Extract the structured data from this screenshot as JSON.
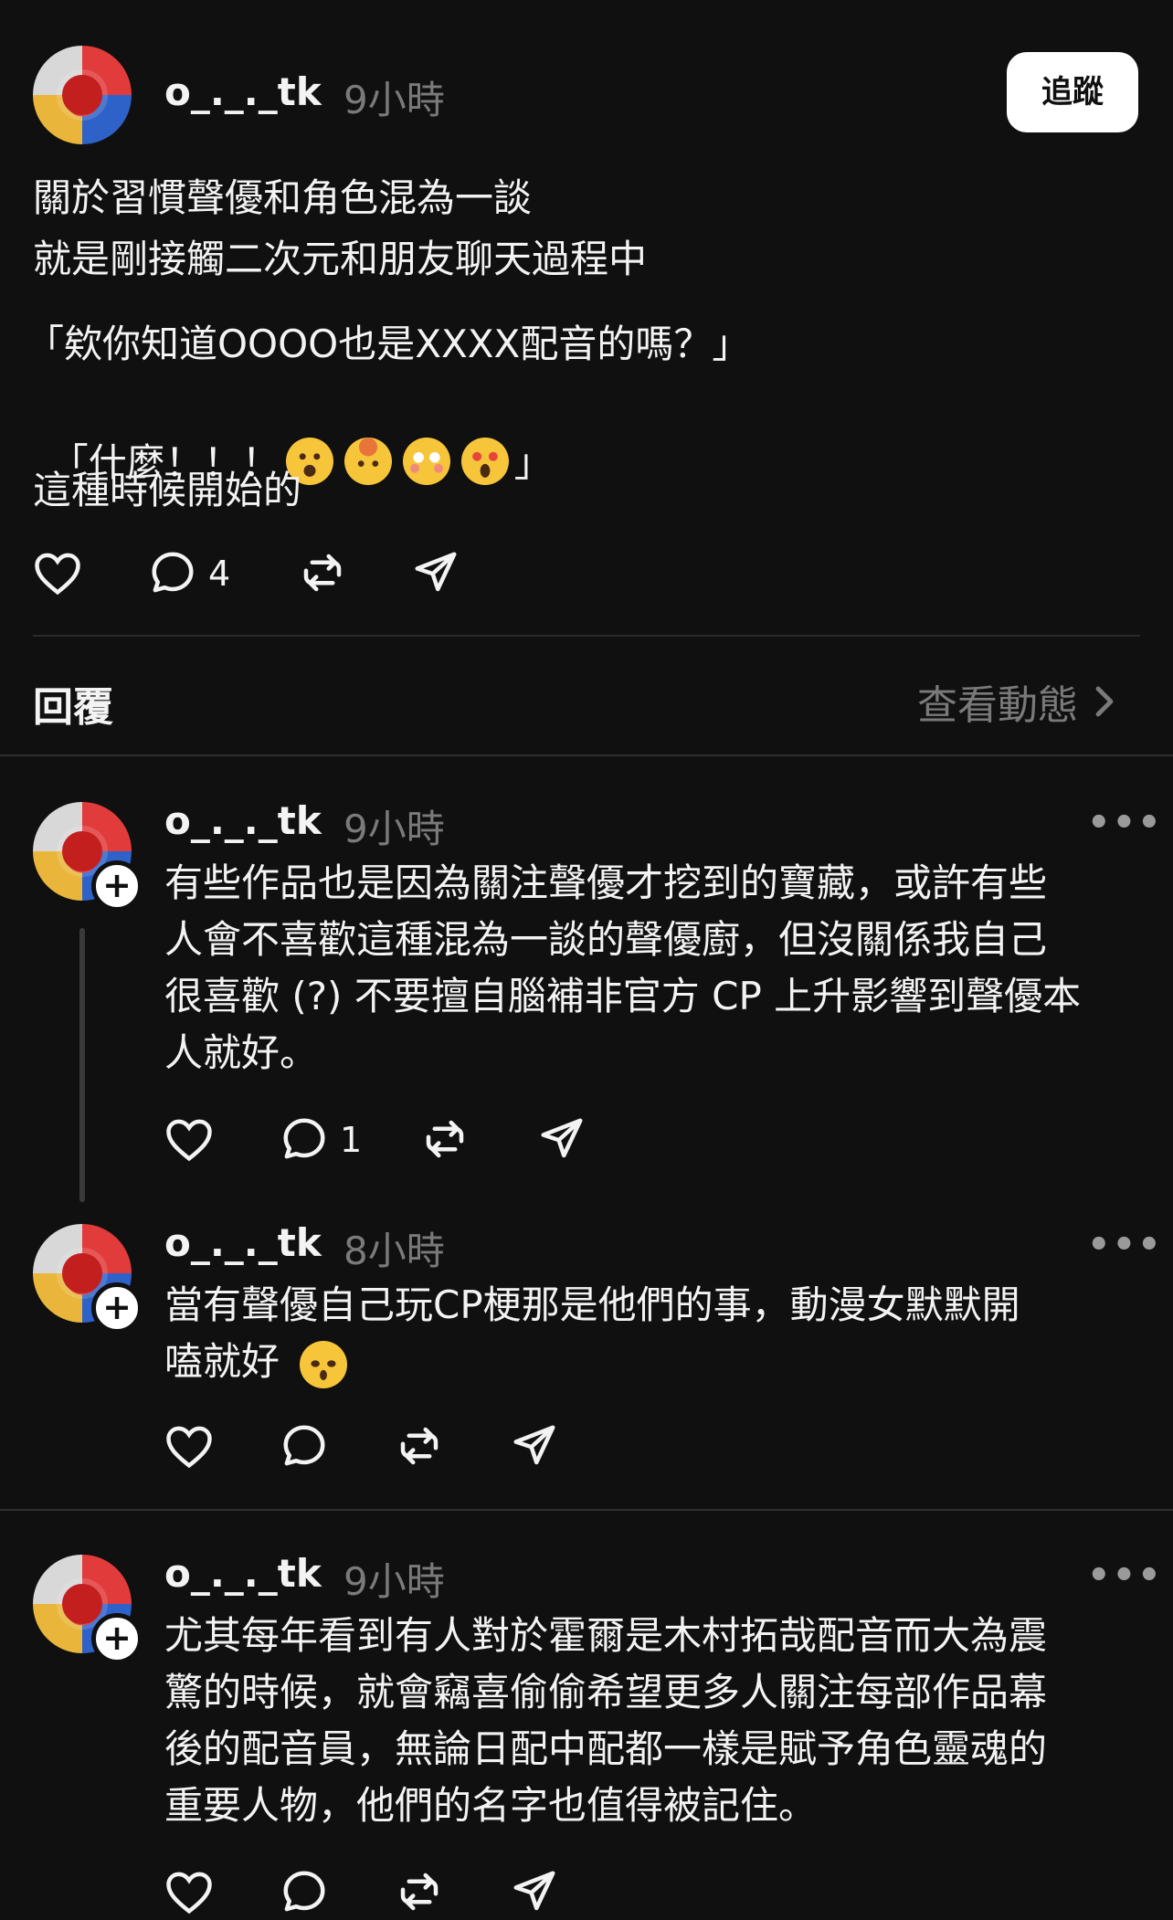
{
  "main_post": {
    "username": "o_._._tk",
    "time": "9小時",
    "follow_label": "追蹤",
    "lines": [
      "關於習慣聲優和角色混為一談",
      "就是剛接觸二次元和朋友聊天過程中",
      "「欸你知道OOOO也是XXXX配音的嗎？」",
      "「什麼！！！",
      "」",
      "這種時候開始的"
    ],
    "reply_count": "4"
  },
  "section": {
    "title": "回覆",
    "link_label": "查看動態"
  },
  "replies": [
    {
      "username": "o_._._tk",
      "time": "9小時",
      "text": "有些作品也是因為關注聲優才挖到的寶藏，或許有些\n人會不喜歡這種混為一談的聲優廚，但沒關係我自己\n很喜歡 (?) 不要擅自腦補非官方 CP 上升影響到聲優本\n人就好。",
      "reply_count": "1"
    },
    {
      "username": "o_._._tk",
      "time": "8小時",
      "text": "當有聲優自己玩CP梗那是他們的事，動漫女默默開\n嗑就好",
      "reply_count": ""
    },
    {
      "username": "o_._._tk",
      "time": "9小時",
      "text": "尤其每年看到有人對於霍爾是木村拓哉配音而大為震\n驚的時候，就會竊喜偷偷希望更多人關注每部作品幕\n後的配音員，無論日配中配都一樣是賦予角色靈魂的\n重要人物，他們的名字也值得被記住。",
      "reply_count": ""
    }
  ],
  "more_label": "•••",
  "icons": [
    "heart-icon",
    "comment-icon",
    "repost-icon",
    "share-icon",
    "chevron-right-icon",
    "plus-icon"
  ],
  "emojis": [
    "hushed-face",
    "exploding-head",
    "flushed-face",
    "star-struck",
    "pensive-face"
  ],
  "colors": {
    "background": "#101010",
    "text": "#f3f3f3",
    "muted": "#7a7a7a",
    "divider": "#2a2a2a"
  }
}
